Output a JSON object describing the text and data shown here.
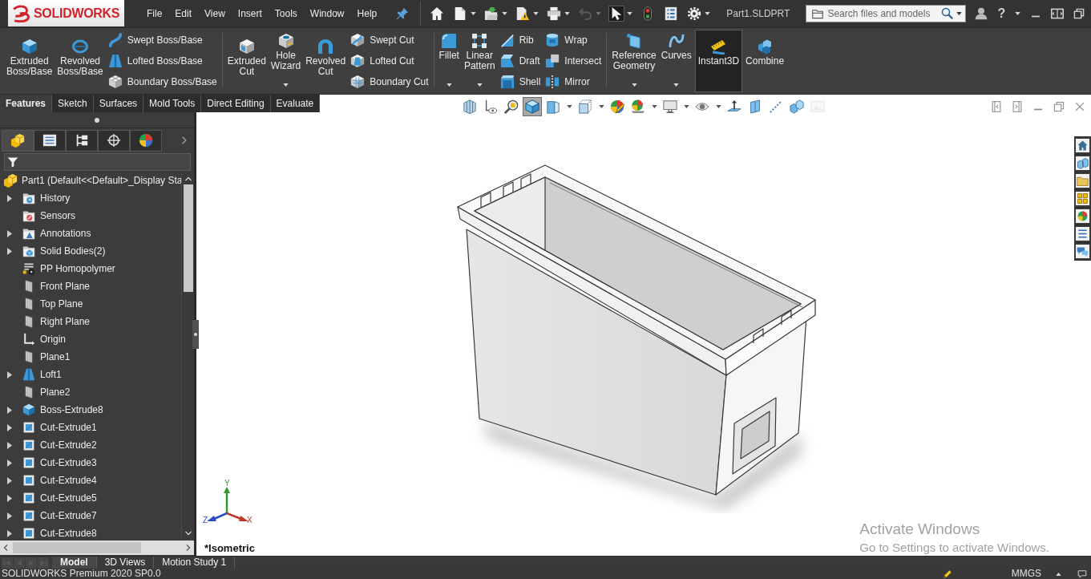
{
  "app_bar": {
    "logo": "SOLIDWORKS",
    "menu": [
      "File",
      "Edit",
      "View",
      "Insert",
      "Tools",
      "Window",
      "Help"
    ],
    "quick_tools": [
      {
        "kind": "home",
        "dropdown": false,
        "selected": false,
        "disabled": false
      },
      {
        "kind": "new",
        "dropdown": true,
        "selected": false,
        "disabled": false
      },
      {
        "kind": "open",
        "dropdown": true,
        "selected": false,
        "disabled": false
      },
      {
        "kind": "save",
        "dropdown": true,
        "selected": false,
        "disabled": false
      },
      {
        "kind": "print",
        "dropdown": true,
        "selected": false,
        "disabled": false
      },
      {
        "kind": "undo",
        "dropdown": true,
        "selected": false,
        "disabled": true
      },
      {
        "kind": "select",
        "dropdown": true,
        "selected": true,
        "disabled": false
      },
      {
        "kind": "rebuild",
        "dropdown": false,
        "selected": false,
        "disabled": false
      },
      {
        "kind": "properties",
        "dropdown": false,
        "selected": false,
        "disabled": false
      },
      {
        "kind": "options",
        "dropdown": true,
        "selected": false,
        "disabled": false
      }
    ],
    "document_title": "Part1.SLDPRT",
    "search": {
      "placeholder": "Search files and models"
    },
    "help": "?"
  },
  "ribbon": {
    "groups": [
      {
        "buttons": [
          {
            "kind": "extrude",
            "label": "Extruded Boss/Base",
            "dropdown": false,
            "on": false
          },
          {
            "kind": "revolve",
            "label": "Revolved Boss/Base",
            "dropdown": false,
            "on": false
          }
        ],
        "stacks": [
          {
            "commands": [
              {
                "kind": "sweep",
                "label": "Swept Boss/Base"
              },
              {
                "kind": "loft",
                "label": "Lofted Boss/Base"
              },
              {
                "kind": "boundary",
                "label": "Boundary Boss/Base"
              }
            ]
          }
        ]
      },
      {
        "buttons": [
          {
            "kind": "extrude-cut",
            "label": "Extruded Cut",
            "dropdown": false,
            "on": false
          },
          {
            "kind": "hole",
            "label": "Hole Wizard",
            "dropdown": true,
            "on": false
          },
          {
            "kind": "revolve-cut",
            "label": "Revolved Cut",
            "dropdown": false,
            "on": false
          }
        ],
        "stacks": [
          {
            "commands": [
              {
                "kind": "sweep-cut",
                "label": "Swept Cut"
              },
              {
                "kind": "loft-cut",
                "label": "Lofted Cut"
              },
              {
                "kind": "boundary-cut",
                "label": "Boundary Cut"
              }
            ]
          }
        ]
      },
      {
        "buttons": [
          {
            "kind": "fillet",
            "label": "Fillet",
            "dropdown": true,
            "on": false
          },
          {
            "kind": "pattern",
            "label": "Linear Pattern",
            "dropdown": true,
            "on": false
          }
        ],
        "stacks": [
          {
            "commands": [
              {
                "kind": "rib",
                "label": "Rib"
              },
              {
                "kind": "draft",
                "label": "Draft"
              },
              {
                "kind": "shell",
                "label": "Shell"
              }
            ]
          },
          {
            "commands": [
              {
                "kind": "wrap",
                "label": "Wrap"
              },
              {
                "kind": "intersect",
                "label": "Intersect"
              },
              {
                "kind": "mirror",
                "label": "Mirror"
              }
            ]
          }
        ]
      },
      {
        "buttons": [
          {
            "kind": "reference",
            "label": "Reference Geometry",
            "dropdown": true,
            "on": false
          },
          {
            "kind": "curves",
            "label": "Curves",
            "dropdown": true,
            "on": false
          },
          {
            "kind": "instant3d",
            "label": "Instant3D",
            "dropdown": false,
            "on": true
          },
          {
            "kind": "combine",
            "label": "Combine",
            "dropdown": false,
            "on": false
          }
        ]
      }
    ]
  },
  "command_tabs": [
    {
      "label": "Features",
      "selected": true
    },
    {
      "label": "Sketch",
      "selected": false
    },
    {
      "label": "Surfaces",
      "selected": false
    },
    {
      "label": "Mold Tools",
      "selected": false
    },
    {
      "label": "Direct Editing",
      "selected": false
    },
    {
      "label": "Evaluate",
      "selected": false
    }
  ],
  "manager_tabs": [
    {
      "kind": "features",
      "selected": true
    },
    {
      "kind": "properties",
      "selected": false
    },
    {
      "kind": "configurations",
      "selected": false
    },
    {
      "kind": "dimxpert",
      "selected": false
    },
    {
      "kind": "display",
      "selected": false
    }
  ],
  "feature_tree": {
    "root": {
      "kind": "part",
      "label": "Part1 (Default<<Default>_Display Sta"
    },
    "items": [
      {
        "kind": "history",
        "label": "History",
        "expanded": false
      },
      {
        "kind": "sensors",
        "label": "Sensors"
      },
      {
        "kind": "annotations",
        "label": "Annotations",
        "expanded": false
      },
      {
        "kind": "bodies",
        "label": "Solid Bodies(2)",
        "expanded": false
      },
      {
        "kind": "material",
        "label": "PP Homopolymer"
      },
      {
        "kind": "plane",
        "label": "Front Plane"
      },
      {
        "kind": "plane",
        "label": "Top Plane"
      },
      {
        "kind": "plane",
        "label": "Right Plane"
      },
      {
        "kind": "origin",
        "label": "Origin"
      },
      {
        "kind": "plane",
        "label": "Plane1"
      },
      {
        "kind": "loft",
        "label": "Loft1",
        "expanded": false
      },
      {
        "kind": "plane",
        "label": "Plane2"
      },
      {
        "kind": "extrude",
        "label": "Boss-Extrude8",
        "expanded": false
      },
      {
        "kind": "cut-extrude",
        "label": "Cut-Extrude1",
        "expanded": false
      },
      {
        "kind": "cut-extrude",
        "label": "Cut-Extrude2",
        "expanded": false
      },
      {
        "kind": "cut-extrude",
        "label": "Cut-Extrude3",
        "expanded": false
      },
      {
        "kind": "cut-extrude",
        "label": "Cut-Extrude4",
        "expanded": false
      },
      {
        "kind": "cut-extrude",
        "label": "Cut-Extrude5",
        "expanded": false
      },
      {
        "kind": "cut-extrude",
        "label": "Cut-Extrude7",
        "expanded": false
      },
      {
        "kind": "cut-extrude",
        "label": "Cut-Extrude8",
        "expanded": false
      }
    ]
  },
  "viewport": {
    "view_tools": [
      {
        "kind": "zoom-fit",
        "dropdown": false,
        "selected": false,
        "disabled": false
      },
      {
        "kind": "zoom-area",
        "dropdown": false,
        "selected": false,
        "disabled": false
      },
      {
        "kind": "previous",
        "dropdown": false,
        "selected": false,
        "disabled": false
      },
      {
        "kind": "orientation",
        "dropdown": false,
        "selected": true,
        "disabled": false
      },
      {
        "kind": "display-style",
        "dropdown": true,
        "selected": false,
        "disabled": false
      },
      {
        "kind": "hide-show",
        "dropdown": true,
        "selected": false,
        "disabled": false
      },
      {
        "kind": "appearance",
        "dropdown": false,
        "selected": false,
        "disabled": false
      },
      {
        "kind": "scene",
        "dropdown": true,
        "selected": false,
        "disabled": false
      },
      {
        "kind": "view-settings",
        "dropdown": true,
        "selected": false,
        "disabled": false
      },
      {
        "kind": "hide",
        "dropdown": true,
        "selected": false,
        "disabled": false
      },
      {
        "kind": "normal-to",
        "dropdown": false,
        "selected": false,
        "disabled": false
      },
      {
        "kind": "section",
        "dropdown": false,
        "selected": false,
        "disabled": false
      },
      {
        "kind": "line",
        "dropdown": false,
        "selected": false,
        "disabled": false
      },
      {
        "kind": "cubes",
        "dropdown": false,
        "selected": false,
        "disabled": false
      },
      {
        "kind": "image",
        "dropdown": false,
        "selected": false,
        "disabled": true
      }
    ],
    "task_pane": [
      {
        "kind": "home"
      },
      {
        "kind": "library"
      },
      {
        "kind": "folder"
      },
      {
        "kind": "palette"
      },
      {
        "kind": "appearances"
      },
      {
        "kind": "properties"
      },
      {
        "kind": "forum"
      }
    ],
    "triad": {
      "x": "X",
      "y": "Y",
      "z": "Z"
    },
    "view_name": "*Isometric",
    "notice": {
      "title": "Activate Windows",
      "text": "Go to Settings to activate Windows."
    }
  },
  "sheet_tabs": [
    {
      "label": "Model",
      "selected": true
    },
    {
      "label": "3D Views",
      "selected": false
    },
    {
      "label": "Motion Study 1",
      "selected": false
    }
  ],
  "status_bar": {
    "product": "SOLIDWORKS Premium 2020 SP0.0",
    "units": "MMGS"
  }
}
